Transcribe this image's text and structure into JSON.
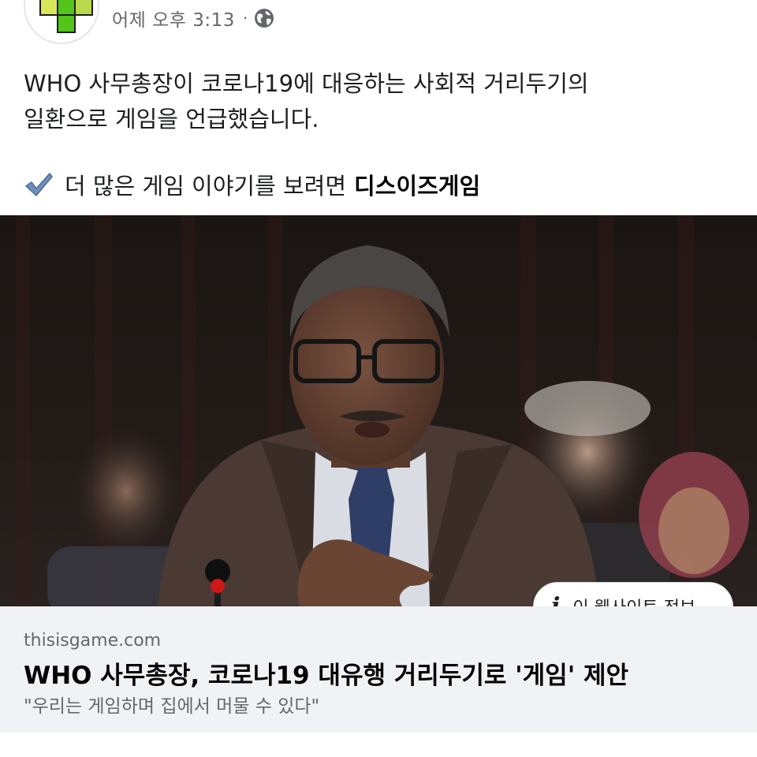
{
  "header": {
    "timestamp": "어제 오후 3:13",
    "separator": "·",
    "privacy_icon": "globe-icon",
    "avatar_icon": "tetris-logo"
  },
  "post": {
    "text_lines": [
      "WHO 사무총장이 코로나19에 대응하는 사회적 거리두기의",
      "일환으로 게임을 언급했습니다."
    ],
    "cta_icon": "check-mark-icon",
    "cta_text": "더 많은 게임 이야기를 보려면",
    "cta_page": "디스이즈게임"
  },
  "link": {
    "info_button_label": "이 웹사이트 정보",
    "info_icon_glyph": "i",
    "domain": "thisisgame.com",
    "title": "WHO 사무총장, 코로나19 대유행 거리두기로 '게임' 제안",
    "description": "\"우리는 게임하며 집에서 머물 수 있다\""
  },
  "colors": {
    "text": "#1c1e21",
    "secondary_text": "#65676b",
    "preview_bg": "#f0f2f5",
    "logo_green": "#52c41a",
    "logo_yellow": "#d8e65a",
    "check_blue": "#6f8fb8"
  }
}
